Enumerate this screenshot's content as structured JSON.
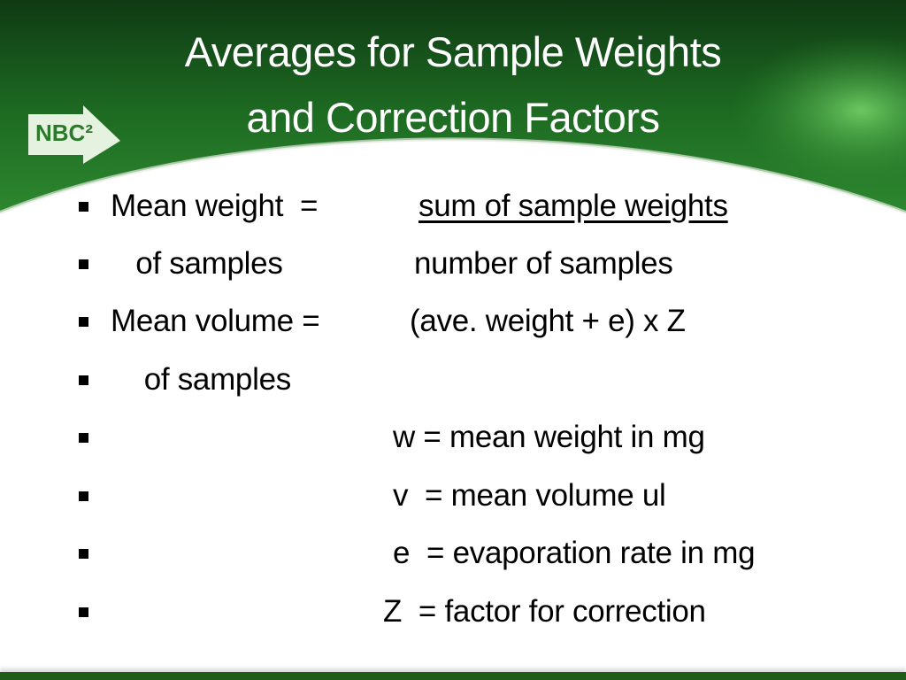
{
  "slide": {
    "title_line1": "Averages for Sample Weights",
    "title_line2": "and Correction Factors",
    "logo_text": "NBC²",
    "brand_color": "#1f5c1a",
    "rows": [
      {
        "left": "Mean weight  =",
        "right": "sum of sample weights"
      },
      {
        "left": "   of samples",
        "right": "number of samples"
      },
      {
        "left": "Mean volume =",
        "right": "(ave. weight + e) x Z"
      },
      {
        "left": "    of samples",
        "right": ""
      },
      {
        "left": "",
        "right": "w = mean weight in mg"
      },
      {
        "left": "",
        "right": "v  = mean volume ul"
      },
      {
        "left": "",
        "right": "e  = evaporation rate in mg"
      },
      {
        "left": "",
        "right": "Z  = factor for correction"
      }
    ]
  }
}
